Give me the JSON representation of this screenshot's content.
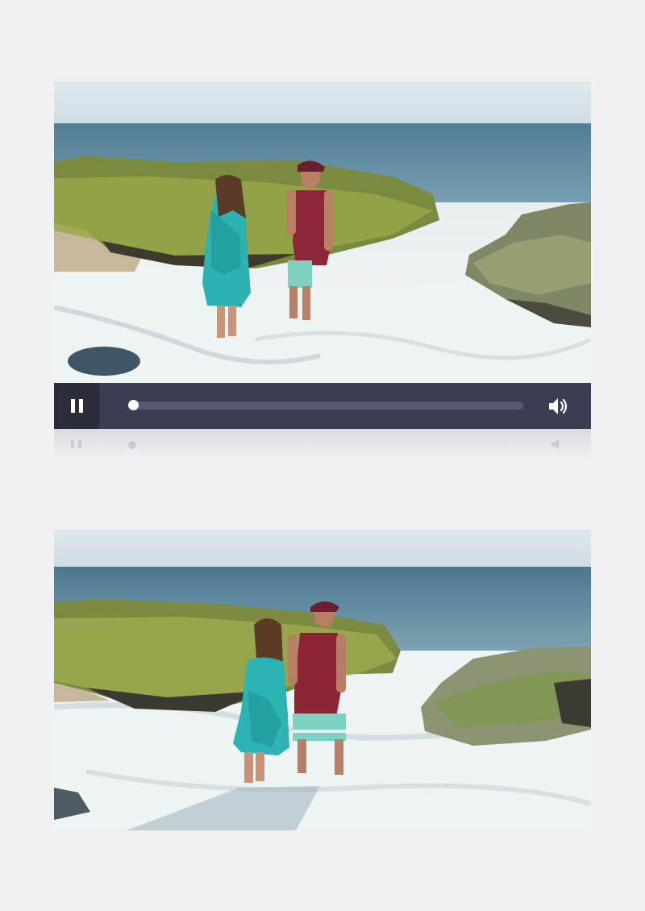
{
  "player": {
    "state": "playing",
    "progress_fraction": 0.0,
    "icons": {
      "pause": "pause-icon",
      "volume": "volume-icon"
    },
    "colors": {
      "control_bar": "#3b3e52",
      "button_bg": "#2a2c3a",
      "track": "#565a72",
      "knob": "#ffffff"
    }
  },
  "frames": [
    {
      "id": "frame-top",
      "scene": "beach-couple-walking-in-surf"
    },
    {
      "id": "frame-bottom",
      "scene": "beach-couple-walking-in-surf"
    }
  ]
}
